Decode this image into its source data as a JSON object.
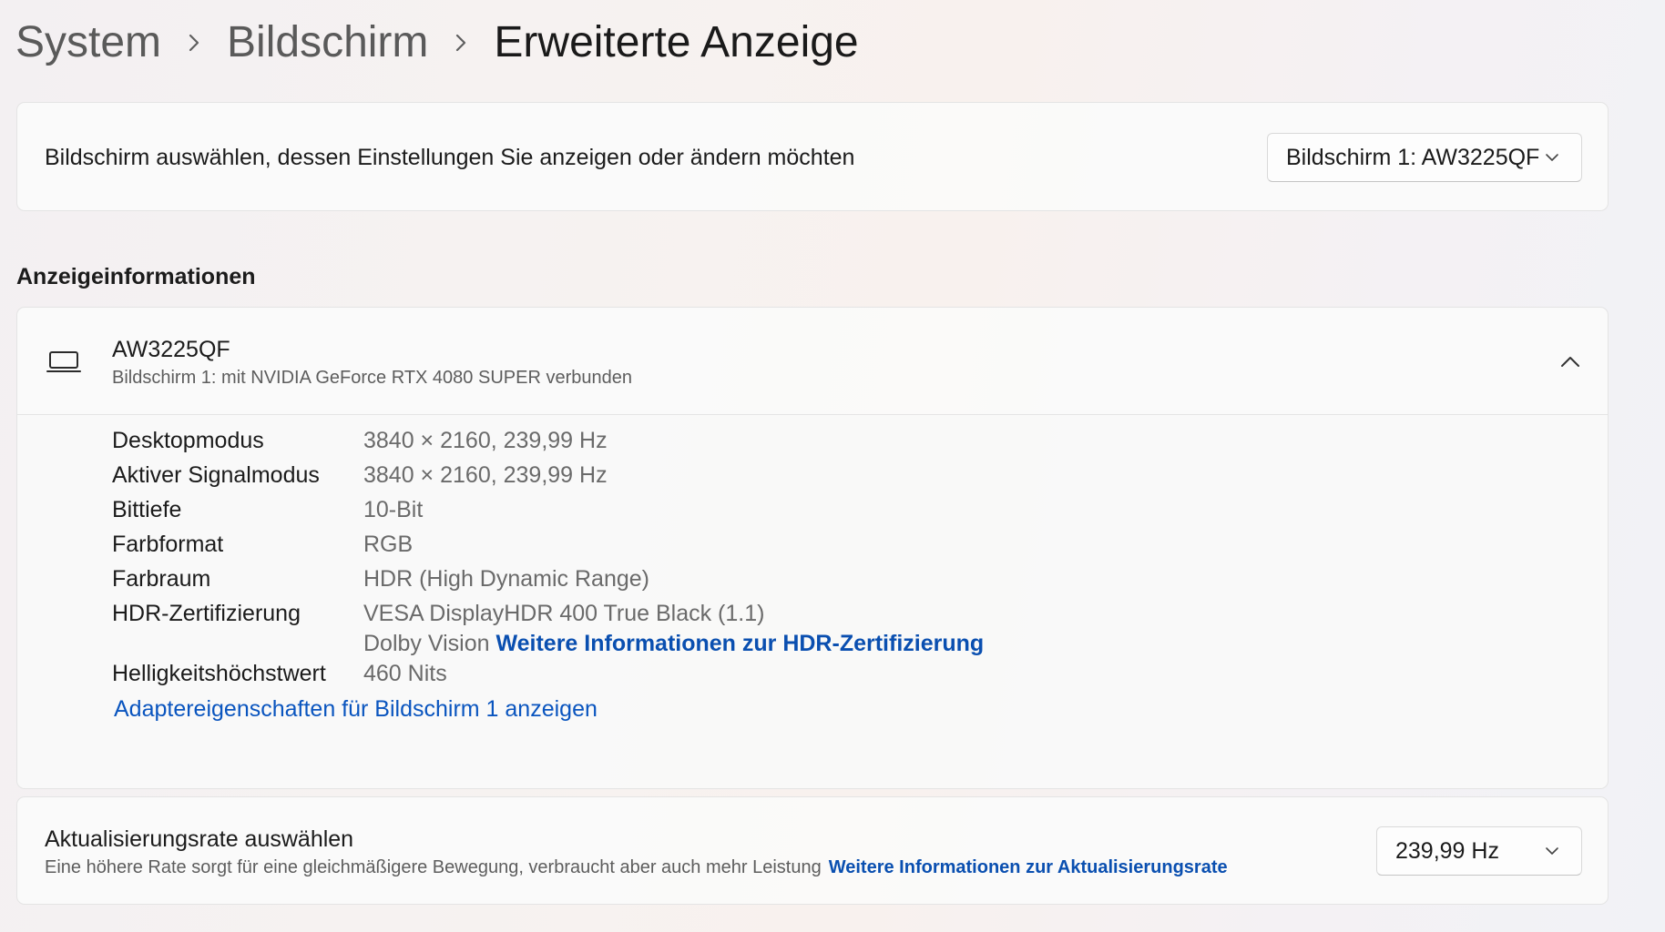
{
  "breadcrumb": {
    "items": [
      "System",
      "Bildschirm"
    ],
    "current": "Erweiterte Anzeige"
  },
  "display_select": {
    "label": "Bildschirm auswählen, dessen Einstellungen Sie anzeigen oder ändern möchten",
    "selected": "Bildschirm 1: AW3225QF"
  },
  "section": {
    "title": "Anzeigeinformationen"
  },
  "display_info": {
    "name": "AW3225QF",
    "subtitle": "Bildschirm 1: mit NVIDIA GeForce RTX 4080 SUPER verbunden",
    "rows": [
      {
        "label": "Desktopmodus",
        "value": "3840 × 2160, 239,99 Hz"
      },
      {
        "label": "Aktiver Signalmodus",
        "value": "3840 × 2160, 239,99 Hz"
      },
      {
        "label": "Bittiefe",
        "value": "10-Bit"
      },
      {
        "label": "Farbformat",
        "value": "RGB"
      },
      {
        "label": "Farbraum",
        "value": "HDR (High Dynamic Range)"
      },
      {
        "label": "HDR-Zertifizierung",
        "value": "VESA DisplayHDR 400 True Black (1.1)",
        "value2": "Dolby Vision",
        "link": "Weitere Informationen zur HDR-Zertifizierung"
      },
      {
        "label": "Helligkeitshöchstwert",
        "value": "460 Nits"
      }
    ],
    "adapter_link": "Adaptereigenschaften für Bildschirm 1 anzeigen"
  },
  "refresh_rate": {
    "title": "Aktualisierungsrate auswählen",
    "description": "Eine höhere Rate sorgt für eine gleichmäßigere Bewegung, verbraucht aber auch mehr Leistung",
    "link": "Weitere Informationen zur Aktualisierungsrate",
    "selected": "239,99 Hz"
  },
  "colors": {
    "link": "#0a4fb0",
    "text_primary": "#1b1b1b",
    "text_secondary": "#6a6a6a"
  },
  "icons": {
    "separator": "chevron-right-icon",
    "dropdown": "chevron-down-icon",
    "collapse": "chevron-up-icon",
    "monitor": "monitor-icon"
  }
}
